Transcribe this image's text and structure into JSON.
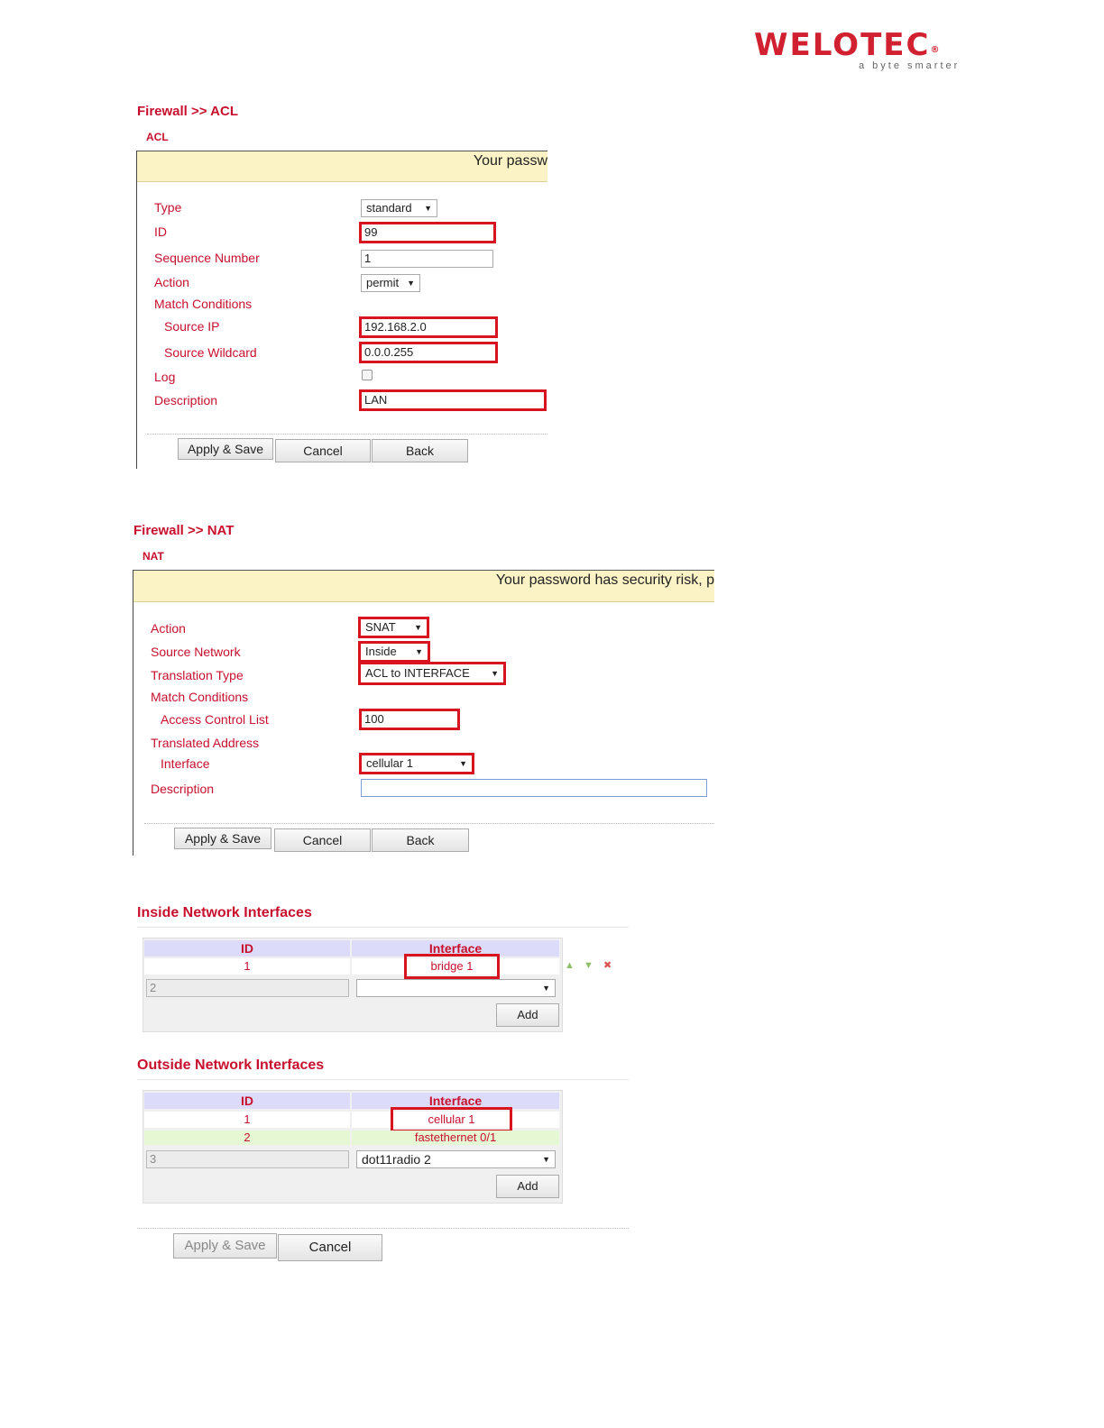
{
  "logo": {
    "word": "WELOTEC",
    "reg": "®",
    "tagline": "a byte smarter"
  },
  "acl": {
    "breadcrumb": "Firewall >> ACL",
    "subtitle": "ACL",
    "banner": "Your passw",
    "labels": {
      "type": "Type",
      "id": "ID",
      "seq": "Sequence Number",
      "action": "Action",
      "match": "Match Conditions",
      "src_ip": "Source IP",
      "src_wild": "Source Wildcard",
      "log": "Log",
      "desc": "Description"
    },
    "values": {
      "type": "standard",
      "id": "99",
      "seq": "1",
      "action": "permit",
      "src_ip": "192.168.2.0",
      "src_wild": "0.0.0.255",
      "desc": "LAN"
    },
    "buttons": {
      "apply": "Apply & Save",
      "cancel": "Cancel",
      "back": "Back"
    }
  },
  "nat": {
    "breadcrumb": "Firewall >> NAT",
    "subtitle": "NAT",
    "banner": "Your password has security risk, p",
    "labels": {
      "action": "Action",
      "src_net": "Source Network",
      "trans_type": "Translation Type",
      "match": "Match Conditions",
      "acl": "Access Control List",
      "trans_addr": "Translated Address",
      "iface": "Interface",
      "desc": "Description"
    },
    "values": {
      "action": "SNAT",
      "src_net": "Inside",
      "trans_type": "ACL to INTERFACE",
      "acl": "100",
      "iface": "cellular 1",
      "desc": ""
    },
    "buttons": {
      "apply": "Apply & Save",
      "cancel": "Cancel",
      "back": "Back"
    }
  },
  "inside": {
    "title": "Inside Network Interfaces",
    "headers": {
      "id": "ID",
      "iface": "Interface"
    },
    "rows": [
      {
        "id": "1",
        "iface": "bridge 1"
      }
    ],
    "new_id": "2",
    "new_iface": "",
    "add": "Add"
  },
  "outside": {
    "title": "Outside Network Interfaces",
    "headers": {
      "id": "ID",
      "iface": "Interface"
    },
    "rows": [
      {
        "id": "1",
        "iface": "cellular 1"
      },
      {
        "id": "2",
        "iface": "fastethernet 0/1"
      }
    ],
    "new_id": "3",
    "new_iface": "dot11radio 2",
    "add": "Add"
  },
  "footer": {
    "apply": "Apply & Save",
    "cancel": "Cancel"
  },
  "arrow": "▼",
  "icons": {
    "up": "▲",
    "down": "▼",
    "delete": "✖"
  },
  "colors": {
    "brand": "#c8102e",
    "highlight": "#d7141f",
    "banner": "#fbf3c6"
  }
}
